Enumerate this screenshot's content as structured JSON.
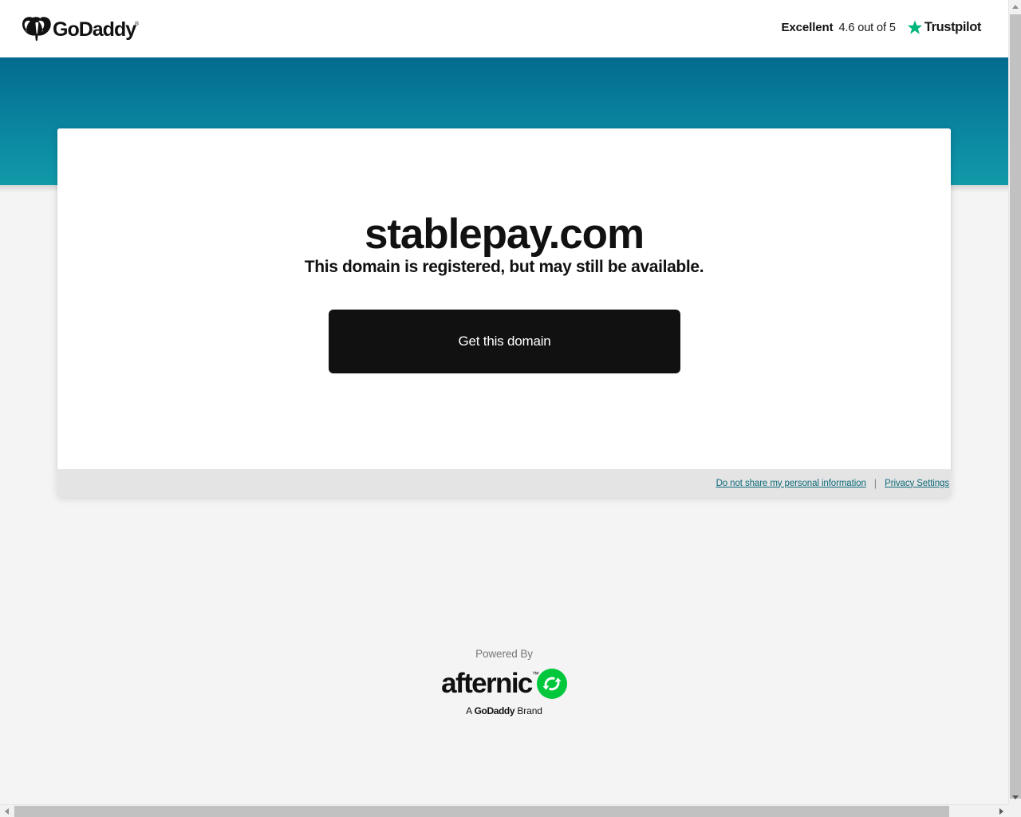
{
  "header": {
    "brand_name": "GoDaddy",
    "brand_logo_icon": "godaddy-heart-logo",
    "trustpilot": {
      "rating_word": "Excellent",
      "rating_text": "4.6 out of 5",
      "logo_name": "Trustpilot",
      "star_icon": "trustpilot-star-icon",
      "star_color": "#00b67a"
    }
  },
  "banner": {
    "gradient_top": "#036b8e",
    "gradient_bottom": "#119aa9"
  },
  "card": {
    "domain_name": "stablepay.com",
    "subtitle": "This domain is registered, but may still be available.",
    "cta_label": "Get this domain",
    "cta_background": "#111111",
    "footer": {
      "do_not_share_link": "Do not share my personal information",
      "divider": "|",
      "privacy_settings_link": "Privacy Settings",
      "link_color": "#0f6b7a"
    }
  },
  "powered_by": {
    "label": "Powered By",
    "wordmark": "afternic",
    "trademark": "™",
    "icon": "afternic-recycle-arrows-icon",
    "icon_color": "#00c73c",
    "brand_line_prefix": "A ",
    "brand_line_brand": "GoDaddy",
    "brand_line_suffix": " Brand"
  },
  "scrollbars": {
    "vertical_up_icon": "scroll-up-arrow-icon",
    "vertical_down_icon": "scroll-down-arrow-icon",
    "horizontal_left_icon": "scroll-left-arrow-icon",
    "horizontal_right_icon": "scroll-right-arrow-icon"
  }
}
